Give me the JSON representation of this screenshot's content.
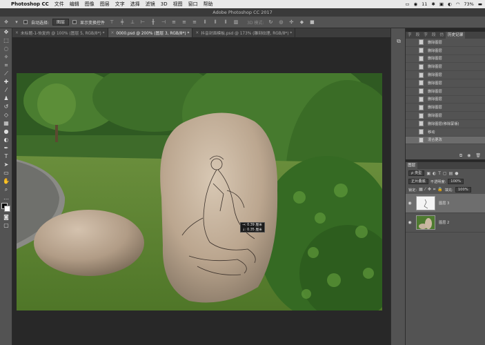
{
  "menubar": {
    "app": "Photoshop CC",
    "items": [
      "文件",
      "编辑",
      "图像",
      "图层",
      "文字",
      "选择",
      "滤镜",
      "3D",
      "视图",
      "窗口",
      "帮助"
    ],
    "status_badge": "11",
    "battery": "73%"
  },
  "window": {
    "title": "Adobe Photoshop CC 2017"
  },
  "options": {
    "auto_select": "自动选择:",
    "auto_select_target": "图层",
    "show_transform": "显示变换控件",
    "mode_3d": "3D 模式:"
  },
  "tabs": [
    {
      "label": "未标题-1-恢复的 @ 100% (图层 5, RGB/8*) *",
      "active": false
    },
    {
      "label": "0000.psd @ 200% (图层 3, RGB/8*) *",
      "active": true
    },
    {
      "label": "抖音封面模板.psd @ 173% (雕刻纹理, RGB/8*) *",
      "active": false
    }
  ],
  "tooltip": {
    "line1": "→: 0.39 厘米",
    "line2": "↓: 0.35 厘米"
  },
  "history": {
    "tabs": [
      "字",
      "段",
      "字",
      "段",
      "仿",
      "历史记录"
    ],
    "items": [
      "删除图层",
      "删除图层",
      "删除图层",
      "删除图层",
      "删除图层",
      "删除图层",
      "删除图层",
      "删除图层",
      "删除图层",
      "删除图层",
      "删除图层(移除蒙版)",
      "移动",
      "混合更改"
    ],
    "selected_index": 12
  },
  "layers": {
    "panel_title": "图层",
    "filter": "ρ 类型",
    "blend_mode": "正片叠底",
    "opacity_label": "不透明度:",
    "opacity": "100%",
    "lock_label": "锁定:",
    "fill_label": "填充:",
    "fill": "100%",
    "items": [
      {
        "name": "图层 3",
        "selected": true
      },
      {
        "name": "图层 2",
        "selected": false
      }
    ]
  },
  "colors": {
    "accent": "#6e6e6e",
    "panel": "#535353",
    "dark": "#282828"
  }
}
